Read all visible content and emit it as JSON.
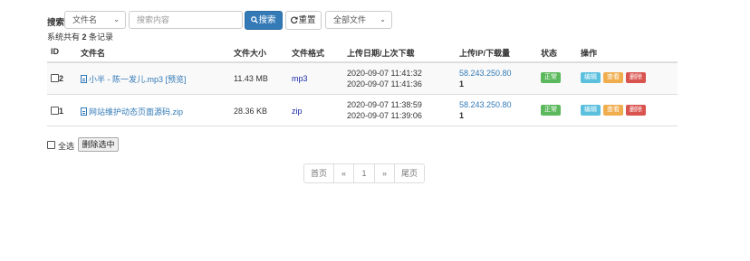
{
  "search": {
    "label": "搜索",
    "field_select": "文件名",
    "placeholder": "搜索内容",
    "search_button": "搜索",
    "reset_button": "重置",
    "type_select": "全部文件"
  },
  "summary": {
    "prefix": "系统共有 ",
    "count": "2",
    "suffix": " 条记录"
  },
  "table": {
    "headers": {
      "id": "ID",
      "name": "文件名",
      "size": "文件大小",
      "format": "文件格式",
      "dates": "上传日期/上次下载",
      "ip": "上传IP/下载量",
      "status": "状态",
      "actions": "操作"
    },
    "rows": [
      {
        "id": "2",
        "name": "小半 - 陈一发儿.mp3",
        "preview": "[预览]",
        "size": "11.43 MB",
        "format": "mp3",
        "upload_date": "2020-09-07 11:41:32",
        "last_download": "2020-09-07 11:41:36",
        "ip": "58.243.250.80",
        "downloads": "1",
        "status": "正常",
        "edit": "编辑",
        "view": "查看",
        "delete": "删除"
      },
      {
        "id": "1",
        "name": "网站维护动态页面源码.zip",
        "preview": "",
        "size": "28.36 KB",
        "format": "zip",
        "upload_date": "2020-09-07 11:38:59",
        "last_download": "2020-09-07 11:39:06",
        "ip": "58.243.250.80",
        "downloads": "1",
        "status": "正常",
        "edit": "编辑",
        "view": "查看",
        "delete": "删除"
      }
    ]
  },
  "bulk": {
    "select_all": "全选",
    "delete_selected": "删除选中"
  },
  "pagination": {
    "first": "首页",
    "prev": "«",
    "current": "1",
    "next": "»",
    "last": "尾页"
  },
  "colors": {
    "primary": "#337ab7",
    "success": "#5cb85c",
    "info": "#5bc0de",
    "warning": "#f0ad4e",
    "danger": "#d9534f"
  }
}
